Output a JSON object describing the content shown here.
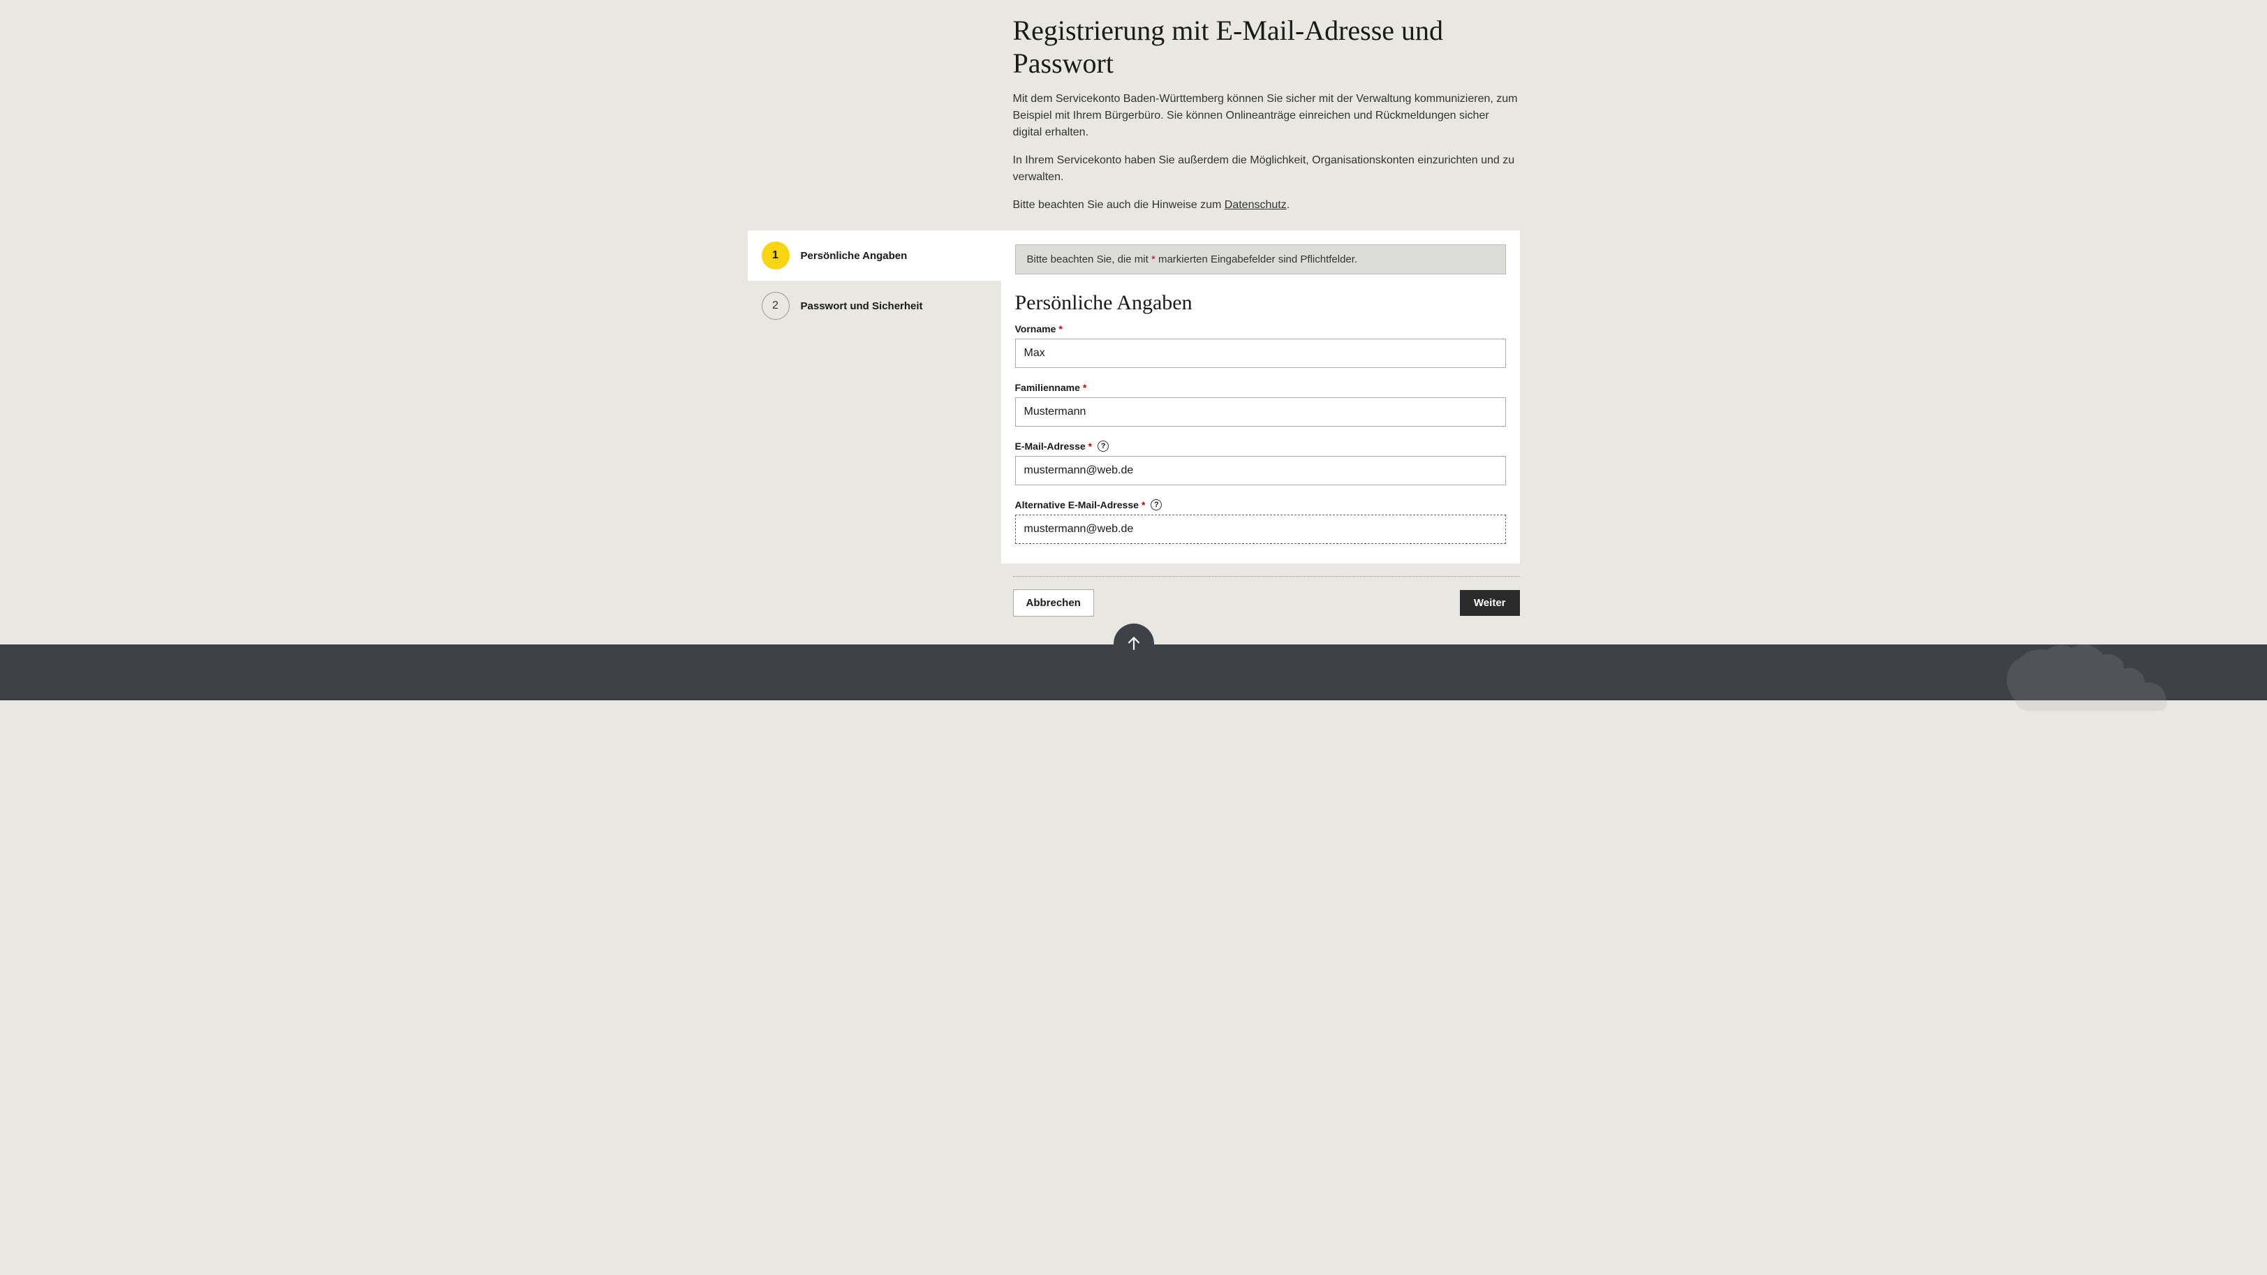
{
  "header": {
    "title": "Registrierung mit E-Mail-Adresse und Passwort",
    "intro1": "Mit dem Servicekonto Baden-Württemberg können Sie sicher mit der Verwaltung kommunizieren, zum Beispiel mit Ihrem Bürgerbüro. Sie können Onlineanträge einreichen und Rückmeldungen sicher digital erhalten.",
    "intro2": "In Ihrem Servicekonto haben Sie außerdem die Möglichkeit, Organisationskonten einzurichten und zu verwalten.",
    "intro3_prefix": "Bitte beachten Sie auch die Hinweise zum ",
    "intro3_link": "Datenschutz",
    "intro3_suffix": "."
  },
  "steps": [
    {
      "number": "1",
      "label": "Persönliche Angaben"
    },
    {
      "number": "2",
      "label": "Passwort und Sicherheit"
    }
  ],
  "notice": {
    "prefix": "Bitte beachten Sie, die mit ",
    "asterisk": "*",
    "suffix": " markierten Eingabefelder sind Pflichtfelder."
  },
  "form": {
    "section_title": "Persönliche Angaben",
    "vorname": {
      "label": "Vorname",
      "value": "Max"
    },
    "familienname": {
      "label": "Familienname",
      "value": "Mustermann"
    },
    "email": {
      "label": "E-Mail-Adresse",
      "value": "mustermann@web.de"
    },
    "alt_email": {
      "label": "Alternative E-Mail-Adresse",
      "value": "mustermann@web.de"
    }
  },
  "actions": {
    "cancel": "Abbrechen",
    "next": "Weiter"
  }
}
